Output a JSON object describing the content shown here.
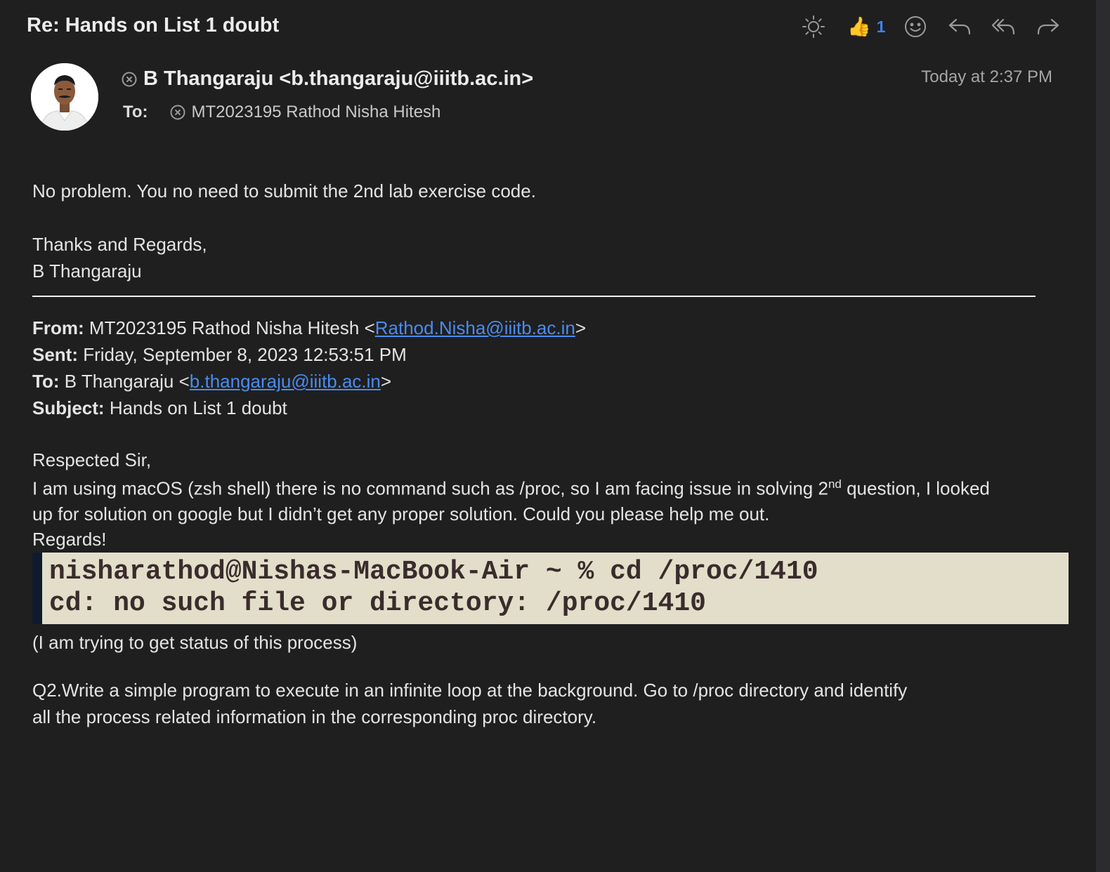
{
  "email": {
    "subject": "Re: Hands on List 1 doubt",
    "reaction": {
      "emoji": "👍",
      "count": "1"
    },
    "icons": {
      "brightness": "sun-icon",
      "emoji": "smiley-icon",
      "reply": "reply-icon",
      "reply_all": "reply-all-icon",
      "forward": "forward-icon"
    },
    "sender": "B Thangaraju <b.thangaraju@iiitb.ac.in>",
    "to_label": "To:",
    "recipient": "MT2023195 Rathod Nisha Hitesh",
    "date": "Today at 2:37 PM",
    "reply_body": {
      "line1": "No problem. You no need to submit the 2nd lab exercise code.",
      "closing": "Thanks and Regards,",
      "signature": "B Thangaraju"
    },
    "quoted_header": {
      "from_label": "From:",
      "from_name": "MT2023195 Rathod Nisha Hitesh <",
      "from_email": "Rathod.Nisha@iiitb.ac.in",
      "from_close": ">",
      "sent_label": "Sent:",
      "sent_value": "Friday, September 8, 2023 12:53:51 PM",
      "to_label": "To:",
      "to_name": "B Thangaraju <",
      "to_email": "b.thangaraju@iiitb.ac.in",
      "to_close": ">",
      "subject_label": "Subject:",
      "subject_value": "Hands on List 1 doubt"
    },
    "quoted_body": {
      "greeting": "Respected Sir,",
      "para1_a": "I am using macOS (zsh shell) there is no command such as /proc, so I am facing issue in solving 2",
      "para1_sup": "nd",
      "para1_b": " question, I looked",
      "para1_line2": "up for solution on google but I didn’t get any proper solution. Could you please help me out.",
      "regards": "Regards!",
      "terminal_line1": "nisharathod@Nishas-MacBook-Air ~ % cd /proc/1410",
      "terminal_line2": "cd: no such file or directory: /proc/1410",
      "note": "(I am trying to get status of this process)",
      "q2_line1": "Q2.Write a simple program to execute in an infinite loop at the background. Go to /proc directory and identify",
      "q2_line2": "all the process related information in the corresponding proc directory."
    }
  }
}
